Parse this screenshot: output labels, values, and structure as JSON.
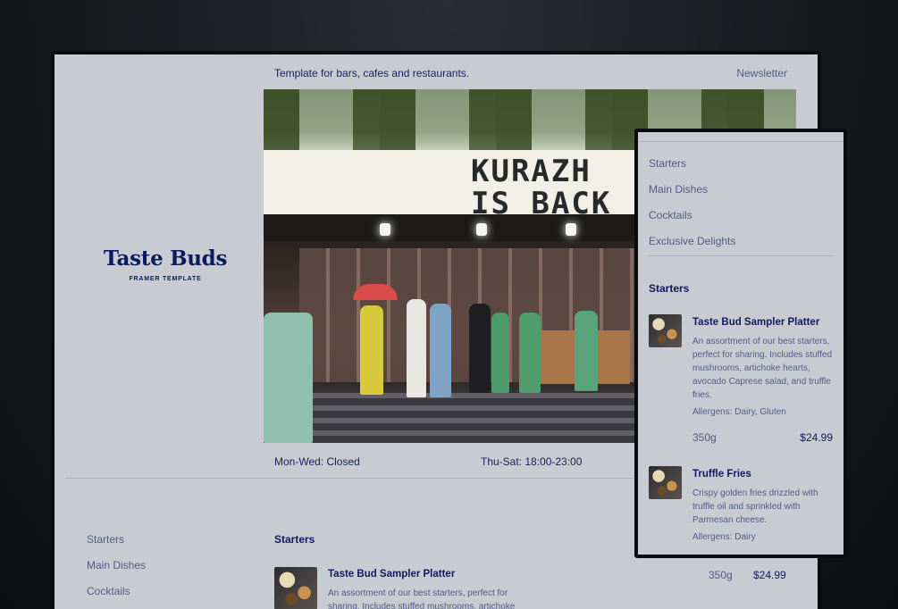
{
  "header": {
    "tagline": "Template for bars, cafes and restaurants.",
    "newsletter": "Newsletter"
  },
  "brand": {
    "title": "Taste Buds",
    "subtitle": "FRAMER TEMPLATE"
  },
  "hero": {
    "sign_line1": "KURAZH",
    "sign_line2": "IS BACK"
  },
  "hours": {
    "weekday": "Mon-Wed: Closed",
    "weekend": "Thu-Sat: 18:00-23:00"
  },
  "nav": {
    "items": [
      "Starters",
      "Main Dishes",
      "Cocktails",
      "Exclusive Delights"
    ]
  },
  "menu": {
    "section_title": "Starters",
    "items": [
      {
        "name": "Taste Bud Sampler Platter",
        "desc_short": "An assortment of our best starters, perfect for sharing. Includes stuffed mushrooms, artichoke",
        "desc": "An assortment of our best starters, perfect for sharing. Includes stuffed mushrooms, artichoke hearts, avocado Caprese salad, and truffle fries.",
        "allergens": "Allergens: Dairy, Gluten",
        "weight": "350g",
        "price": "$24.99"
      },
      {
        "name": "Truffle Fries",
        "desc": "Crispy golden fries drizzled with truffle oil and sprinkled with Parmesan cheese.",
        "allergens": "Allergens: Dairy"
      }
    ]
  },
  "colors": {
    "background": "#c9cbd2",
    "text_primary": "#0c1a5e",
    "text_muted": "#4f5b85"
  }
}
